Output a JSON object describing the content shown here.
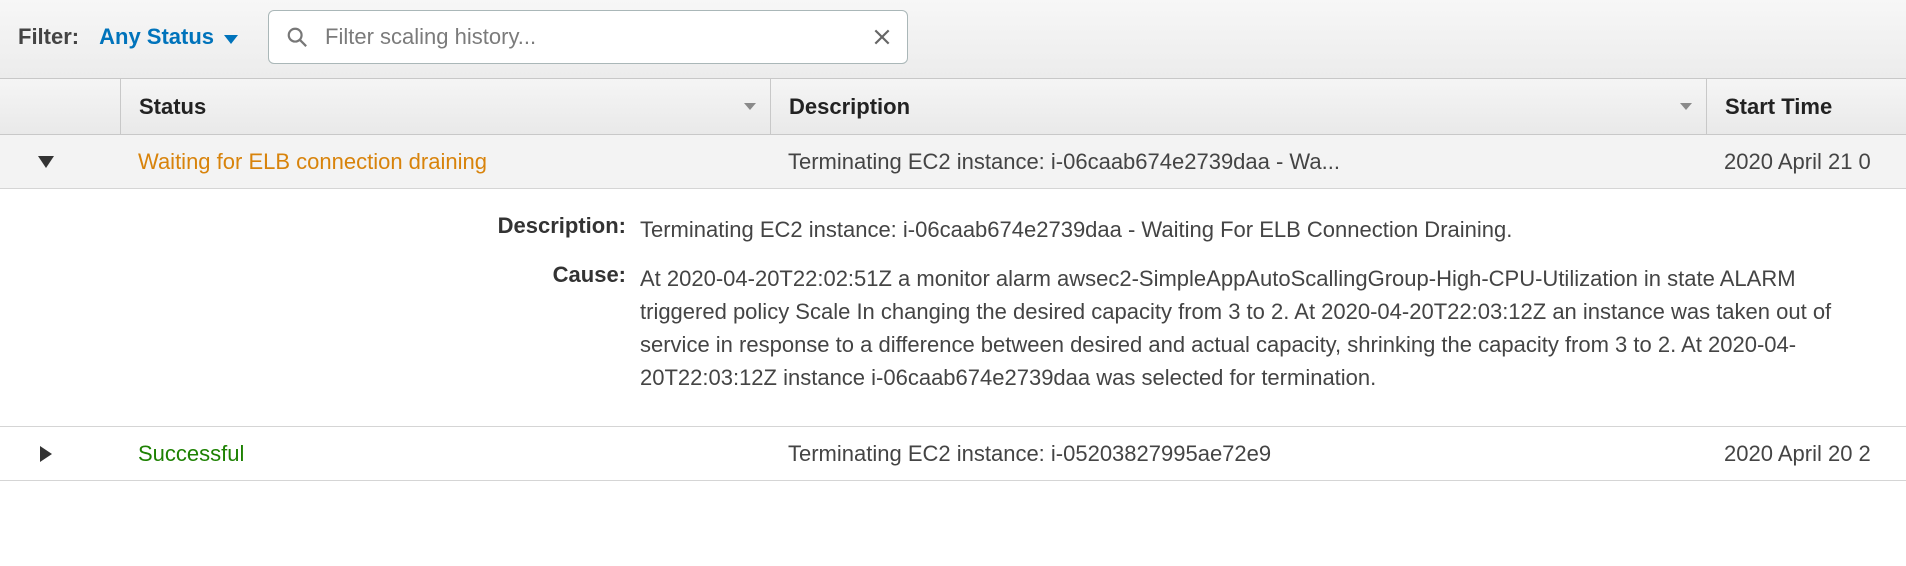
{
  "filter": {
    "label": "Filter:",
    "selected": "Any Status",
    "search_placeholder": "Filter scaling history..."
  },
  "columns": {
    "status": "Status",
    "description": "Description",
    "start_time": "Start Time"
  },
  "rows": [
    {
      "expanded": true,
      "status_kind": "waiting",
      "status": "Waiting for ELB connection draining",
      "description_short": "Terminating EC2 instance: i-06caab674e2739daa - Wa...",
      "start_time": "2020 April 21 0",
      "detail": {
        "description_label": "Description:",
        "description": "Terminating EC2 instance: i-06caab674e2739daa - Waiting For ELB Connection Draining.",
        "cause_label": "Cause:",
        "cause": "At 2020-04-20T22:02:51Z a monitor alarm awsec2-SimpleAppAutoScallingGroup-High-CPU-Utilization in state ALARM triggered policy Scale In changing the desired capacity from 3 to 2. At 2020-04-20T22:03:12Z an instance was taken out of service in response to a difference between desired and actual capacity, shrinking the capacity from 3 to 2. At 2020-04-20T22:03:12Z instance i-06caab674e2739daa was selected for termination."
      }
    },
    {
      "expanded": false,
      "status_kind": "success",
      "status": "Successful",
      "description_short": "Terminating EC2 instance: i-05203827995ae72e9",
      "start_time": "2020 April 20 2"
    }
  ]
}
